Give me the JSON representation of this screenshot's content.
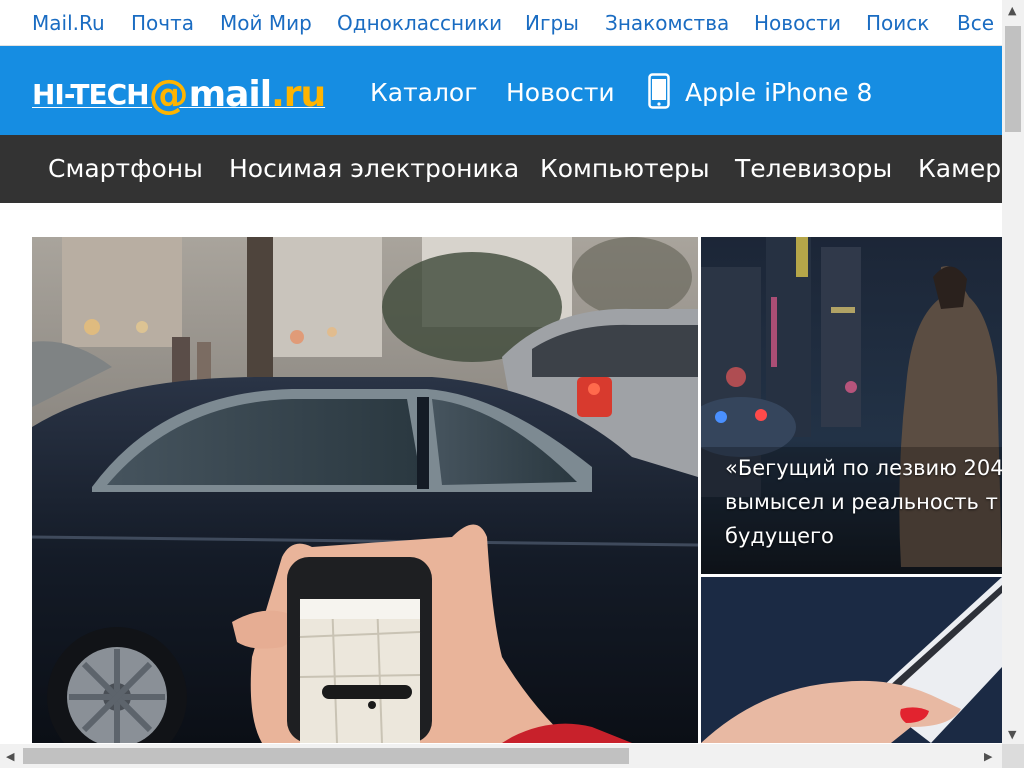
{
  "portal_nav": {
    "items": [
      {
        "label": "Mail.Ru"
      },
      {
        "label": "Почта"
      },
      {
        "label": "Мой Мир"
      },
      {
        "label": "Одноклассники"
      },
      {
        "label": "Игры"
      },
      {
        "label": "Знакомства"
      },
      {
        "label": "Новости"
      },
      {
        "label": "Поиск"
      },
      {
        "label": "Все"
      }
    ]
  },
  "brand": {
    "logo_hi": "HI-TECH",
    "logo_at": "@",
    "logo_mail": "mail",
    "logo_ru": ".ru",
    "nav": [
      {
        "label": "Каталог"
      },
      {
        "label": "Новости"
      },
      {
        "label": "Apple iPhone 8",
        "icon": "smartphone-icon"
      }
    ]
  },
  "categories": {
    "items": [
      {
        "label": "Смартфоны"
      },
      {
        "label": "Носимая электроника"
      },
      {
        "label": "Компьютеры"
      },
      {
        "label": "Телевизоры"
      },
      {
        "label": "Камер"
      }
    ]
  },
  "featured": {
    "side1_caption_lines": [
      "«Бегущий по лезвию 204",
      "вымысел и реальность т",
      "будущего"
    ]
  },
  "colors": {
    "brand_blue": "#168de2",
    "category_bar": "#333333",
    "portal_link": "#1a6cc2",
    "logo_accent": "#ffb400"
  }
}
